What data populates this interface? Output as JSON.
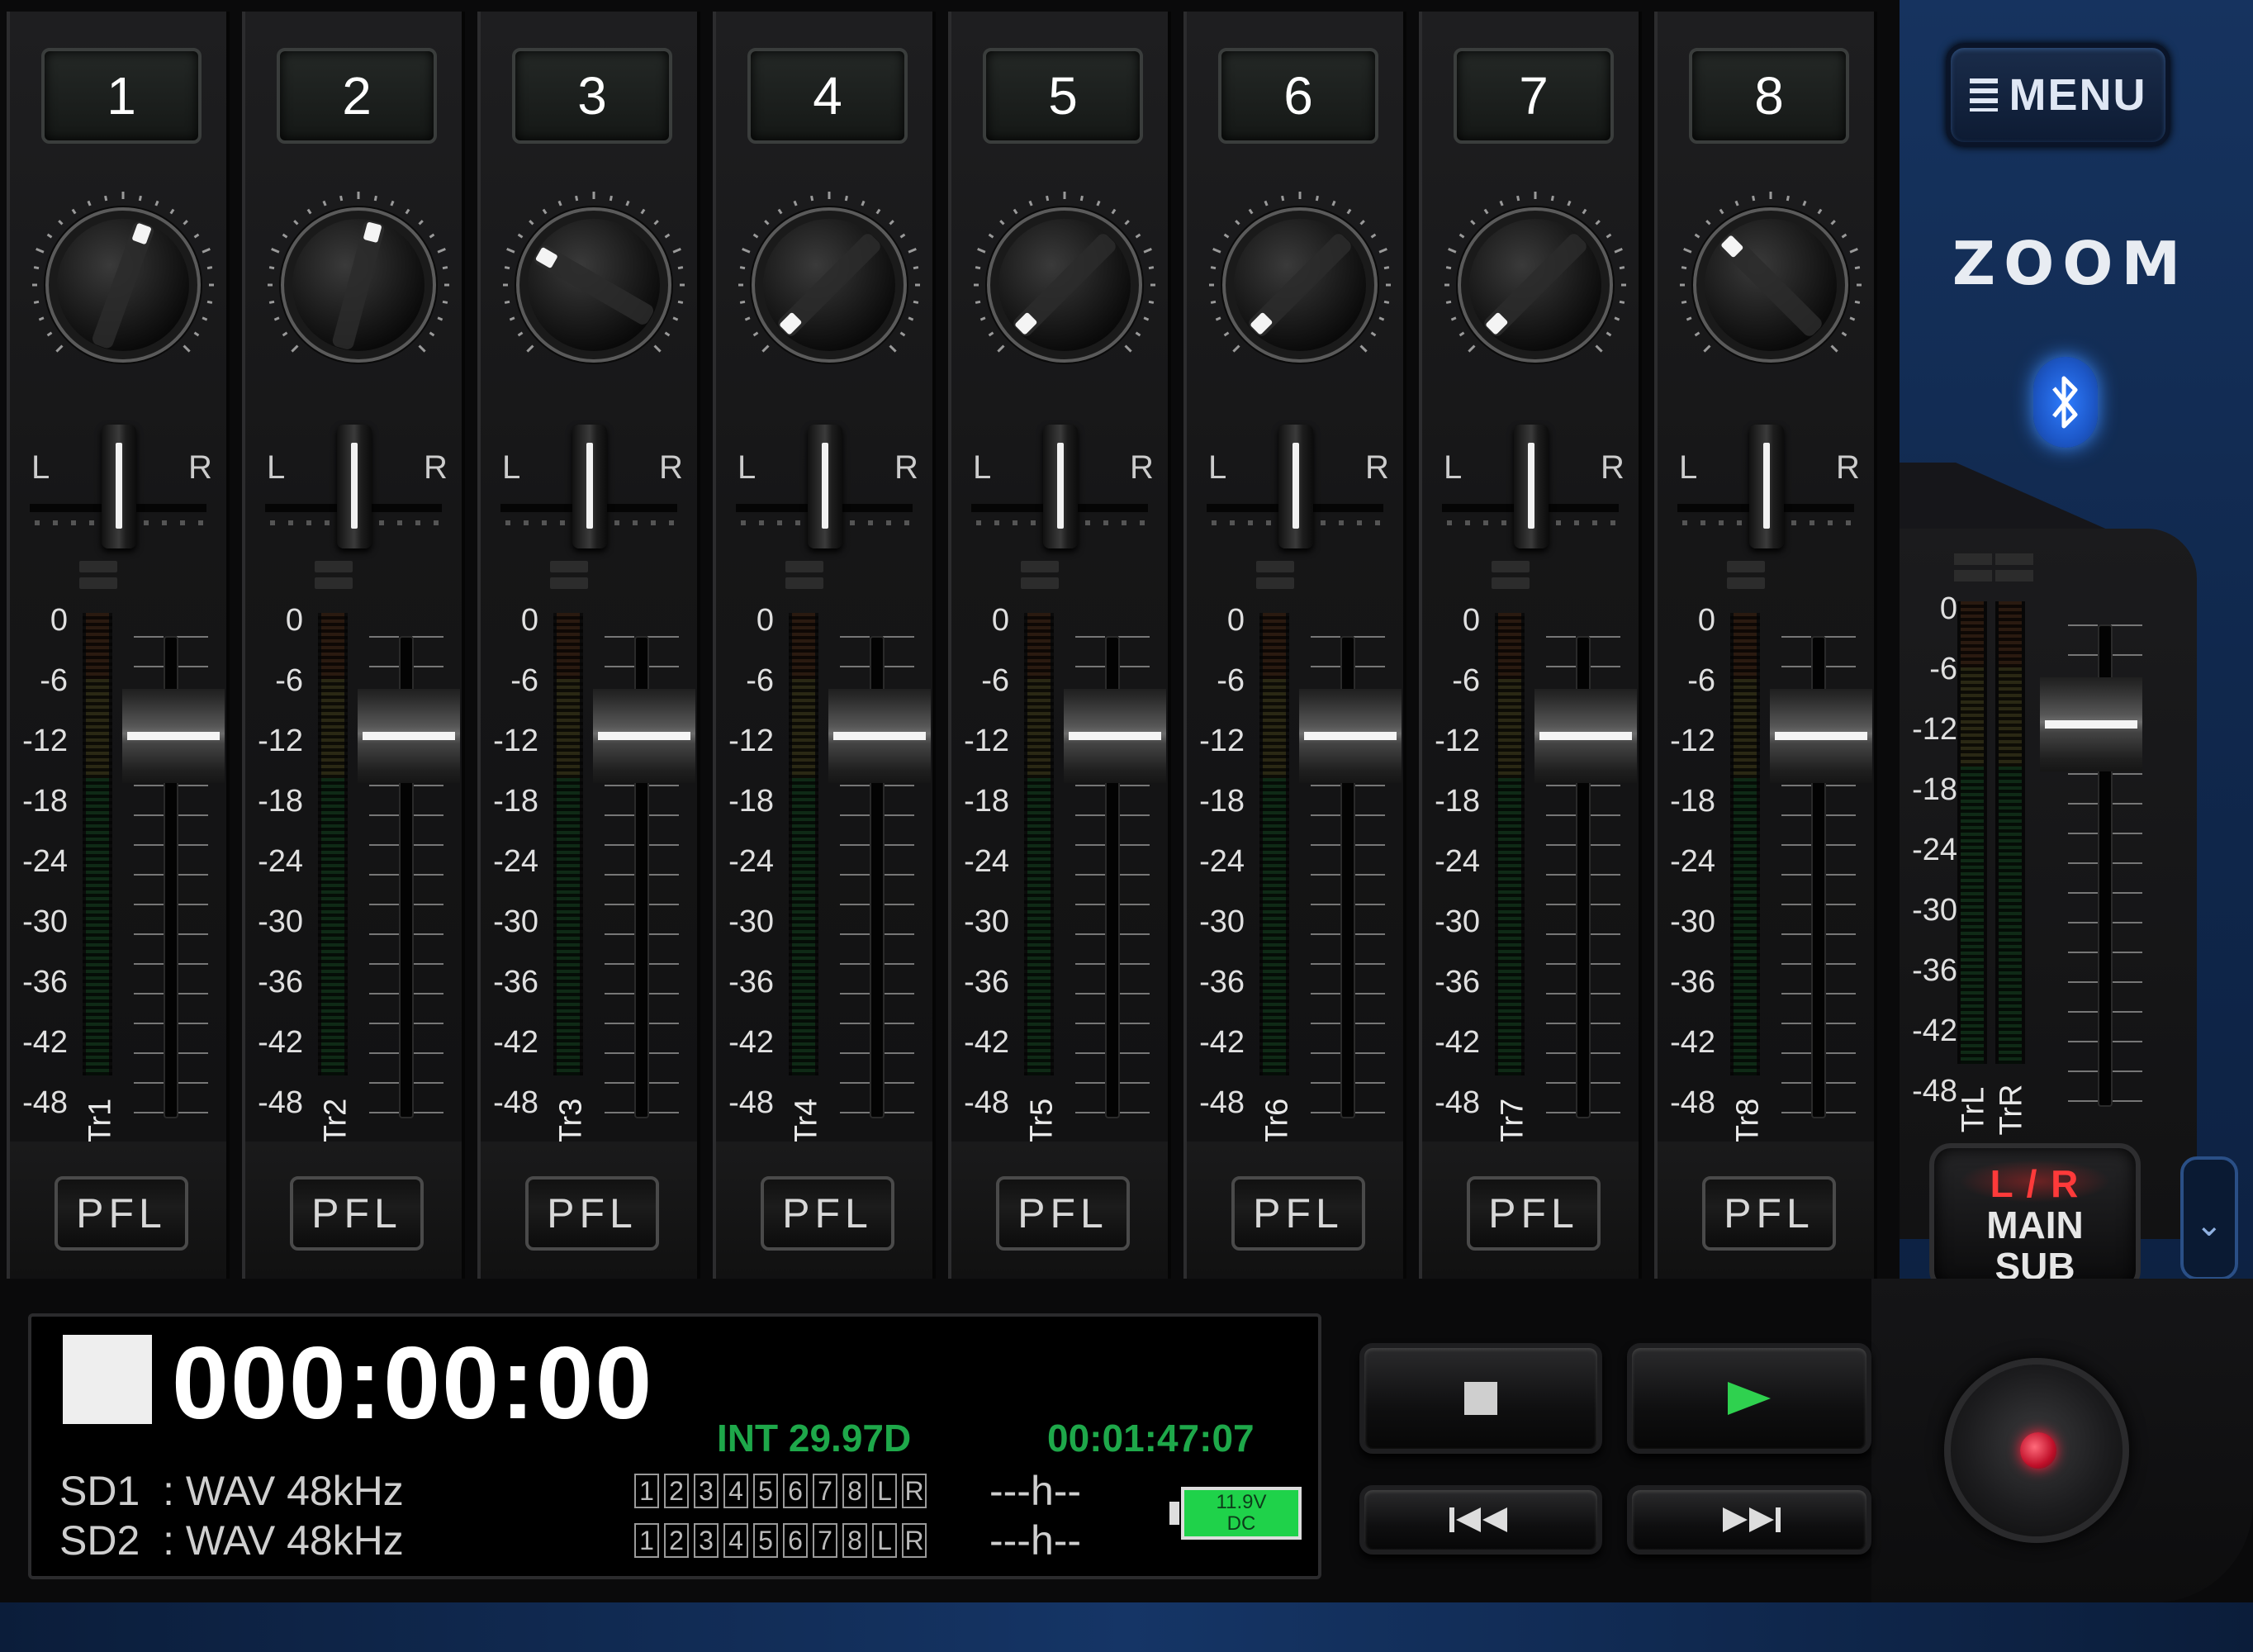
{
  "channels": [
    {
      "number": "1",
      "label": "Tr1",
      "knob_angle": 20,
      "pfl": "PFL"
    },
    {
      "number": "2",
      "label": "Tr2",
      "knob_angle": 15,
      "pfl": "PFL"
    },
    {
      "number": "3",
      "label": "Tr3",
      "knob_angle": -60,
      "pfl": "PFL"
    },
    {
      "number": "4",
      "label": "Tr4",
      "knob_angle": -135,
      "pfl": "PFL"
    },
    {
      "number": "5",
      "label": "Tr5",
      "knob_angle": -135,
      "pfl": "PFL"
    },
    {
      "number": "6",
      "label": "Tr6",
      "knob_angle": -135,
      "pfl": "PFL"
    },
    {
      "number": "7",
      "label": "Tr7",
      "knob_angle": -135,
      "pfl": "PFL"
    },
    {
      "number": "8",
      "label": "Tr8",
      "knob_angle": -45,
      "pfl": "PFL"
    }
  ],
  "pan": {
    "left": "L",
    "right": "R"
  },
  "scale": [
    "0",
    "-6",
    "-12",
    "-18",
    "-24",
    "-30",
    "-36",
    "-42",
    "-48"
  ],
  "master": {
    "left_label": "TrL",
    "right_label": "TrR"
  },
  "sidebar": {
    "menu_label": "MENU",
    "logo": "ZOOM",
    "bluetooth_icon": "bluetooth-icon",
    "output_button": {
      "line1": "L / R",
      "line2": "MAIN",
      "line3": "SUB"
    },
    "side_tab_icon": "chevron-icon"
  },
  "display": {
    "timecode": "000:00:00",
    "frame_rate": "INT 29.97D",
    "remaining": "00:01:47:07",
    "sd1": {
      "label": "SD1",
      "format": ": WAV 48kHz",
      "remain": "---h--"
    },
    "sd2": {
      "label": "SD2",
      "format": ": WAV 48kHz",
      "remain": "---h--"
    },
    "tracks": [
      "1",
      "2",
      "3",
      "4",
      "5",
      "6",
      "7",
      "8",
      "L",
      "R"
    ],
    "battery_voltage": "11.9V",
    "battery_type": "DC"
  },
  "transport": {
    "stop_icon": "stop-icon",
    "play_icon": "play-icon",
    "rewind_icon": "rewind-icon",
    "fastforward_icon": "fast-forward-icon",
    "record_icon": "record-icon"
  },
  "colors": {
    "accent_blue": "#16335f",
    "timecode_green": "#1ea84a",
    "record_red": "#ff1f3c",
    "play_green": "#2fd14f"
  }
}
